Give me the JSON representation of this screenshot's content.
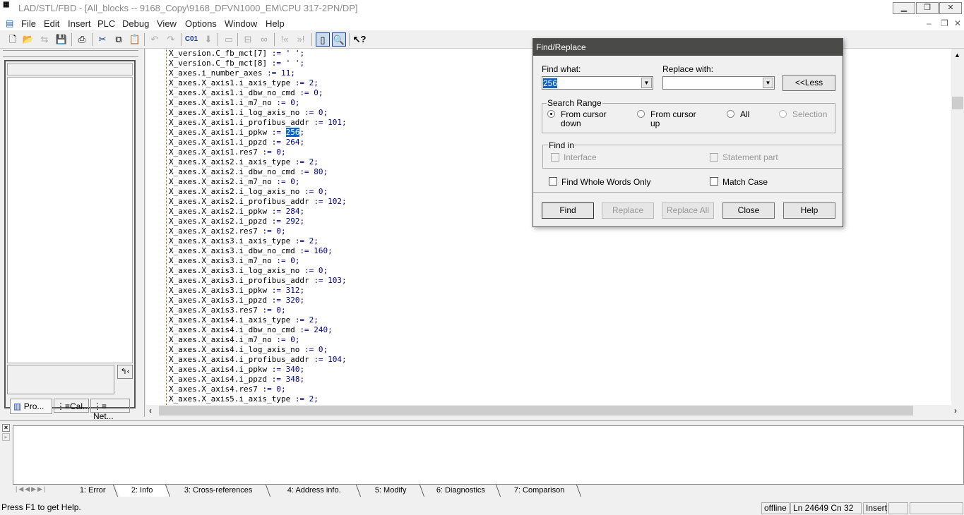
{
  "title": "LAD/STL/FBD  - [All_blocks -- 9168_Copy\\9168_DFVN1000_EM\\CPU 317-2PN/DP]",
  "menu": [
    "File",
    "Edit",
    "Insert",
    "PLC",
    "Debug",
    "View",
    "Options",
    "Window",
    "Help"
  ],
  "left_tabs": [
    "Pro...",
    "Cal...",
    "Net..."
  ],
  "code_lines": [
    "X_version.C_fb_mct[7] := ' ';",
    "X_version.C_fb_mct[8] := ' ';",
    "X_axes.i_number_axes := 11;",
    "X_axes.X_axis1.i_axis_type := 2;",
    "X_axes.X_axis1.i_dbw_no_cmd := 0;",
    "X_axes.X_axis1.i_m7_no := 0;",
    "X_axes.X_axis1.i_log_axis_no := 0;",
    "X_axes.X_axis1.i_profibus_addr := 101;",
    "X_axes.X_axis1.i_ppkw := 256;",
    "X_axes.X_axis1.i_ppzd := 264;",
    "X_axes.X_axis1.res7 := 0;",
    "X_axes.X_axis2.i_axis_type := 2;",
    "X_axes.X_axis2.i_dbw_no_cmd := 80;",
    "X_axes.X_axis2.i_m7_no := 0;",
    "X_axes.X_axis2.i_log_axis_no := 0;",
    "X_axes.X_axis2.i_profibus_addr := 102;",
    "X_axes.X_axis2.i_ppkw := 284;",
    "X_axes.X_axis2.i_ppzd := 292;",
    "X_axes.X_axis2.res7 := 0;",
    "X_axes.X_axis3.i_axis_type := 2;",
    "X_axes.X_axis3.i_dbw_no_cmd := 160;",
    "X_axes.X_axis3.i_m7_no := 0;",
    "X_axes.X_axis3.i_log_axis_no := 0;",
    "X_axes.X_axis3.i_profibus_addr := 103;",
    "X_axes.X_axis3.i_ppkw := 312;",
    "X_axes.X_axis3.i_ppzd := 320;",
    "X_axes.X_axis3.res7 := 0;",
    "X_axes.X_axis4.i_axis_type := 2;",
    "X_axes.X_axis4.i_dbw_no_cmd := 240;",
    "X_axes.X_axis4.i_m7_no := 0;",
    "X_axes.X_axis4.i_log_axis_no := 0;",
    "X_axes.X_axis4.i_profibus_addr := 104;",
    "X_axes.X_axis4.i_ppkw := 340;",
    "X_axes.X_axis4.i_ppzd := 348;",
    "X_axes.X_axis4.res7 := 0;",
    "X_axes.X_axis5.i_axis_type := 2;"
  ],
  "selected_text": "256",
  "selected_line_index": 8,
  "output_tabs": [
    "1: Error",
    "2: Info",
    "3: Cross-references",
    "4: Address info.",
    "5: Modify",
    "6: Diagnostics",
    "7: Comparison"
  ],
  "status": {
    "help": "Press F1 to get Help.",
    "mode": "offline",
    "position": "Ln 24649 Cn 32",
    "insert": "Insert"
  },
  "dialog": {
    "title": "Find/Replace",
    "find_label": "Find what:",
    "find_value": "256",
    "replace_label": "Replace with:",
    "replace_value": "",
    "less_button": "<<Less",
    "search_range_label": "Search Range",
    "range_options": [
      {
        "label": "From cursor\ndown",
        "selected": true,
        "enabled": true
      },
      {
        "label": "From cursor\nup",
        "selected": false,
        "enabled": true
      },
      {
        "label": "All",
        "selected": false,
        "enabled": true
      },
      {
        "label": "Selection",
        "selected": false,
        "enabled": false
      }
    ],
    "find_in_label": "Find in",
    "interface_label": "Interface",
    "statement_label": "Statement part",
    "whole_words_label": "Find Whole Words Only",
    "match_case_label": "Match Case",
    "buttons": {
      "find": "Find",
      "replace": "Replace",
      "replace_all": "Replace All",
      "close": "Close",
      "help": "Help"
    }
  }
}
